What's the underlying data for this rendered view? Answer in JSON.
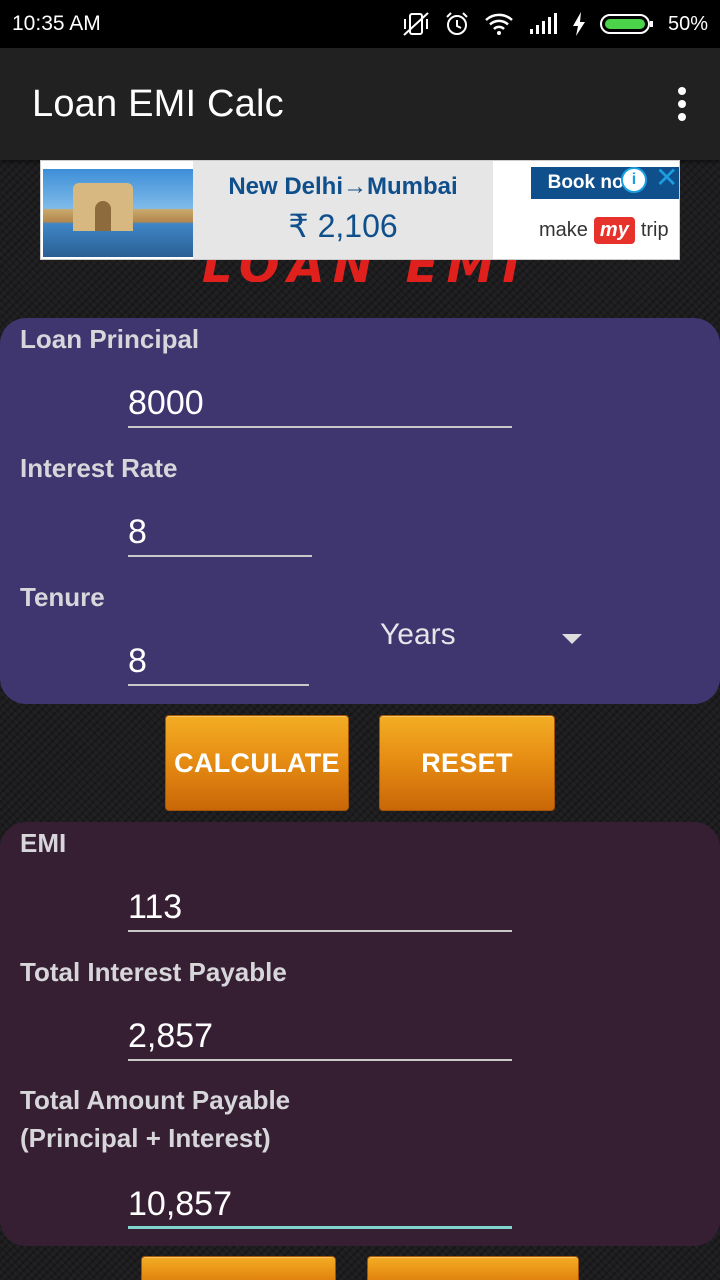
{
  "status_bar": {
    "time": "10:35 AM",
    "battery_percent": "50%"
  },
  "app_bar": {
    "title": "Loan EMI Calc"
  },
  "ad": {
    "route": "New Delhi→Mumbai",
    "price": "₹ 2,106",
    "cta": "Book now",
    "info": "i",
    "close": "✕",
    "brand_left": "make",
    "brand_mid": "my",
    "brand_right": "trip"
  },
  "banner_title": "LOAN EMI CALC",
  "inputs": {
    "principal_label": "Loan Principal",
    "principal_value": "8000",
    "rate_label": "Interest Rate",
    "rate_value": "8",
    "tenure_label": "Tenure",
    "tenure_value": "8",
    "tenure_unit": "Years"
  },
  "buttons": {
    "calculate": "CALCULATE",
    "reset": "RESET"
  },
  "results": {
    "emi_label": "EMI",
    "emi_value": "113",
    "interest_label": "Total Interest Payable",
    "interest_value": "2,857",
    "total_label_line1": "Total Amount Payable",
    "total_label_line2": "(Principal + Interest)",
    "total_value": "10,857"
  },
  "colors": {
    "input_panel": "#3f356f",
    "output_panel": "#371f33",
    "button_orange": "#e58a12",
    "title_red": "#e0201c",
    "focus_underline": "#7fd4d0"
  },
  "icons": [
    "vibrate-off-icon",
    "alarm-icon",
    "wifi-icon",
    "signal-icon",
    "charging-icon",
    "battery-icon",
    "overflow-menu-icon",
    "dropdown-caret-icon",
    "ad-info-icon",
    "ad-close-icon"
  ]
}
